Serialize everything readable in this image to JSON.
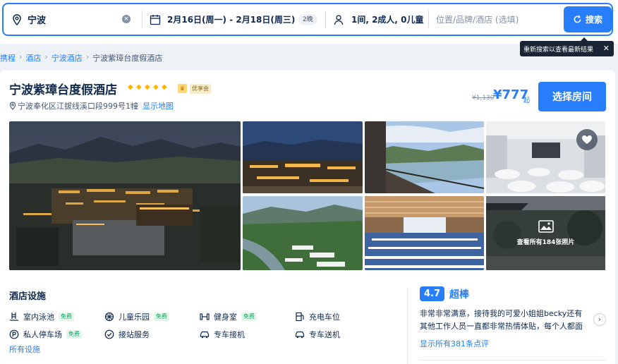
{
  "search": {
    "city": "宁波",
    "date_range": "2月16日(周一)  -  2月18日(周三)",
    "nights": "2晚",
    "guests": "1间, 2成人, 0儿童",
    "keyword_placeholder": "位置/品牌/酒店 (选填)",
    "search_label": "搜索",
    "tooltip": "重新搜索以查看最新结果"
  },
  "breadcrumb": [
    "携程",
    "酒店",
    "宁波酒店",
    "宁波紫璋台度假酒店"
  ],
  "hotel": {
    "name": "宁波紫璋台度假酒店",
    "badge": "优享会",
    "address": "宁波奉化区江拔线溪口段999号1幢",
    "show_map": "显示地图",
    "old_price": "¥1,130",
    "price": "¥777",
    "price_suffix": "起",
    "select_room": "选择房间"
  },
  "gallery": {
    "view_all": "查看所有184张照片"
  },
  "facilities": {
    "title": "酒店设施",
    "items": [
      {
        "label": "室内泳池",
        "free": "免费",
        "icon": "pool-icon"
      },
      {
        "label": "儿童乐园",
        "free": "免费",
        "icon": "playground-icon"
      },
      {
        "label": "健身室",
        "free": "免费",
        "icon": "gym-icon"
      },
      {
        "label": "充电车位",
        "free": "",
        "icon": "ev-charging-icon"
      },
      {
        "label": "私人停车场",
        "free": "免费",
        "icon": "parking-icon"
      },
      {
        "label": "接站服务",
        "free": "",
        "icon": "check-circle-icon"
      },
      {
        "label": "专车接机",
        "free": "",
        "icon": "pickup-car-icon"
      },
      {
        "label": "专车送机",
        "free": "",
        "icon": "dropoff-car-icon"
      }
    ],
    "all_label": "所有设施"
  },
  "review": {
    "score": "4.7",
    "word": "超棒",
    "text": "非常非常满意，接待我的可爱小姐姐becky还有其他工作人员一直都非常热情体贴，每个人都面带微笑...",
    "all_label": "显示所有381条点评"
  },
  "colors": {
    "accent": "#287dfa",
    "text": "#0f294d",
    "free_green": "#06a55c",
    "diamond": "#ffb400"
  }
}
